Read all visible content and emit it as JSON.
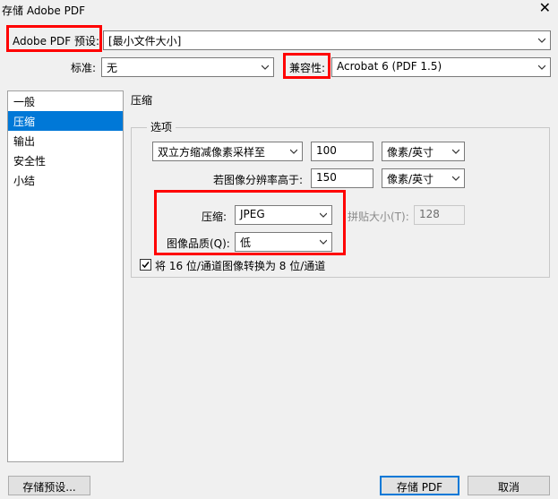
{
  "window": {
    "title": "存储 Adobe PDF",
    "close_glyph": "✕"
  },
  "preset": {
    "label": "Adobe PDF 预设:",
    "value": "[最小文件大小]"
  },
  "standard": {
    "label": "标准:",
    "value": "无"
  },
  "compat": {
    "label": "兼容性:",
    "value": "Acrobat 6 (PDF 1.5)"
  },
  "sidebar": {
    "items": [
      {
        "label": "一般"
      },
      {
        "label": "压缩"
      },
      {
        "label": "输出"
      },
      {
        "label": "安全性"
      },
      {
        "label": "小结"
      }
    ],
    "selected_index": 1
  },
  "panel": {
    "heading": "压缩",
    "group_title": "选项",
    "downsample_method": "双立方缩减像素采样至",
    "ppi_value": "100",
    "ppi_unit": "像素/英寸",
    "threshold_label": "若图像分辨率高于:",
    "threshold_value": "150",
    "threshold_unit": "像素/英寸",
    "compression_label": "压缩:",
    "compression_value": "JPEG",
    "tile_label": "拼贴大小(T):",
    "tile_value": "128",
    "quality_label": "图像品质(Q):",
    "quality_value": "低",
    "convert_label": "将 16 位/通道图像转换为 8 位/通道",
    "convert_checked": true
  },
  "buttons": {
    "save_preset": "存储预设...",
    "save_pdf": "存储 PDF",
    "cancel": "取消"
  },
  "colors": {
    "highlight": "#ff0000",
    "selection": "#0078d7"
  }
}
